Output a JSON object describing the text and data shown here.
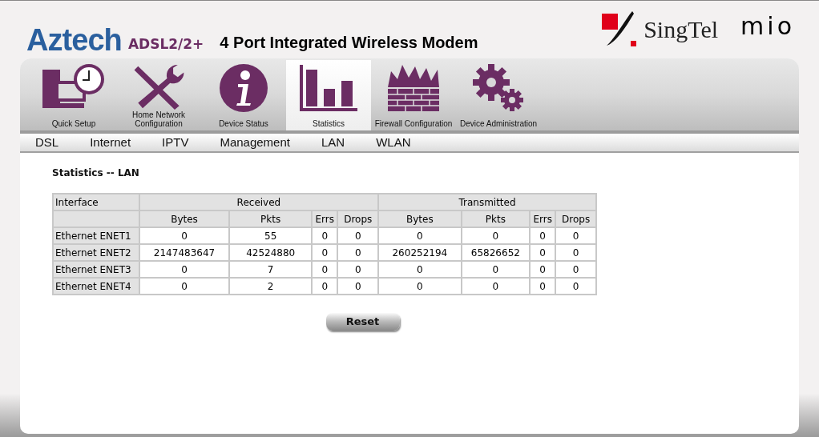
{
  "header": {
    "brand": "Aztech",
    "brand_accent": "ADSL2/2+",
    "title": "4 Port Integrated Wireless Modem",
    "partner": "SingTel",
    "partner_logo": "mio"
  },
  "nav": [
    {
      "label": "Quick Setup",
      "kind": "computer",
      "selected": false
    },
    {
      "label": "Home Network Configuration",
      "kind": "tools",
      "selected": false
    },
    {
      "label": "Device Status",
      "kind": "info",
      "selected": false
    },
    {
      "label": "Statistics",
      "kind": "chart",
      "selected": true
    },
    {
      "label": "Firewall Configuration",
      "kind": "firewall",
      "selected": false
    },
    {
      "label": "Device Administration",
      "kind": "gears",
      "selected": false
    }
  ],
  "subnav": [
    "DSL",
    "Internet",
    "IPTV",
    "Management",
    "LAN",
    "WLAN"
  ],
  "section_title": "Statistics -- LAN",
  "table": {
    "corner": "Interface",
    "groups": [
      "Received",
      "Transmitted"
    ],
    "columns": [
      "Bytes",
      "Pkts",
      "Errs",
      "Drops",
      "Bytes",
      "Pkts",
      "Errs",
      "Drops"
    ],
    "rows": [
      {
        "interface": "Ethernet ENET1",
        "cells": [
          "0",
          "55",
          "0",
          "0",
          "0",
          "0",
          "0",
          "0"
        ]
      },
      {
        "interface": "Ethernet ENET2",
        "cells": [
          "2147483647",
          "42524880",
          "0",
          "0",
          "260252194",
          "65826652",
          "0",
          "0"
        ]
      },
      {
        "interface": "Ethernet ENET3",
        "cells": [
          "0",
          "7",
          "0",
          "0",
          "0",
          "0",
          "0",
          "0"
        ]
      },
      {
        "interface": "Ethernet ENET4",
        "cells": [
          "0",
          "2",
          "0",
          "0",
          "0",
          "0",
          "0",
          "0"
        ]
      }
    ]
  },
  "reset_button": "Reset"
}
